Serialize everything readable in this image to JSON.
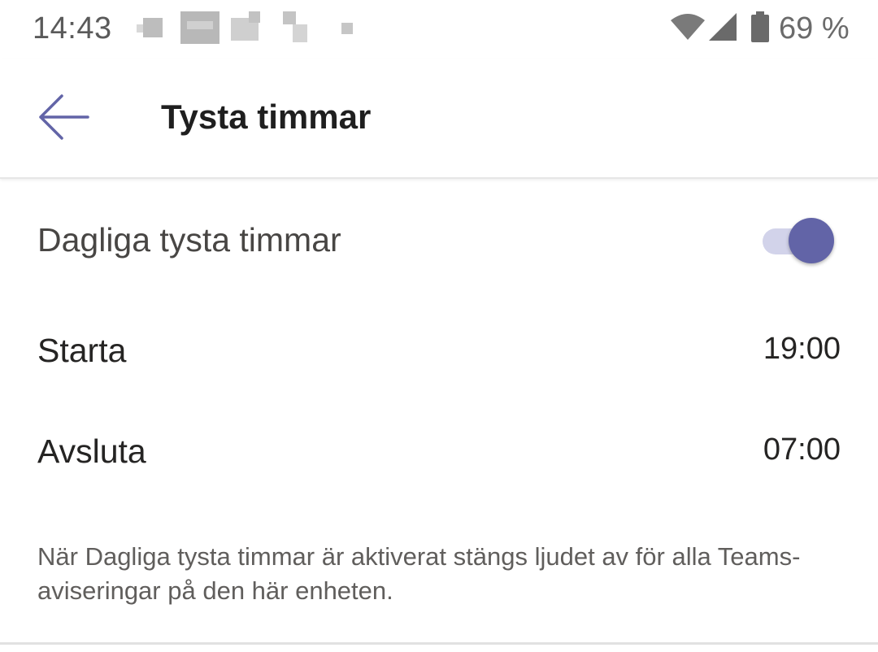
{
  "status_bar": {
    "time": "14:43",
    "battery": "69 %",
    "icons": [
      "wifi-icon",
      "signal-icon",
      "battery-icon"
    ]
  },
  "app_bar": {
    "back_icon": "arrow-left-icon",
    "title": "Tysta timmar"
  },
  "settings": {
    "daily_quiet_hours": {
      "label": "Dagliga tysta timmar",
      "enabled": true
    },
    "start": {
      "label": "Starta",
      "value": "19:00"
    },
    "end": {
      "label": "Avsluta",
      "value": "07:00"
    },
    "description": "När Dagliga tysta timmar är aktiverat stängs ljudet av för alla Teams-aviseringar på den här enheten."
  },
  "colors": {
    "accent": "#6264a7",
    "toggle_track": "#d2d3ea",
    "text_primary": "#252423",
    "text_secondary": "#605e5c"
  }
}
